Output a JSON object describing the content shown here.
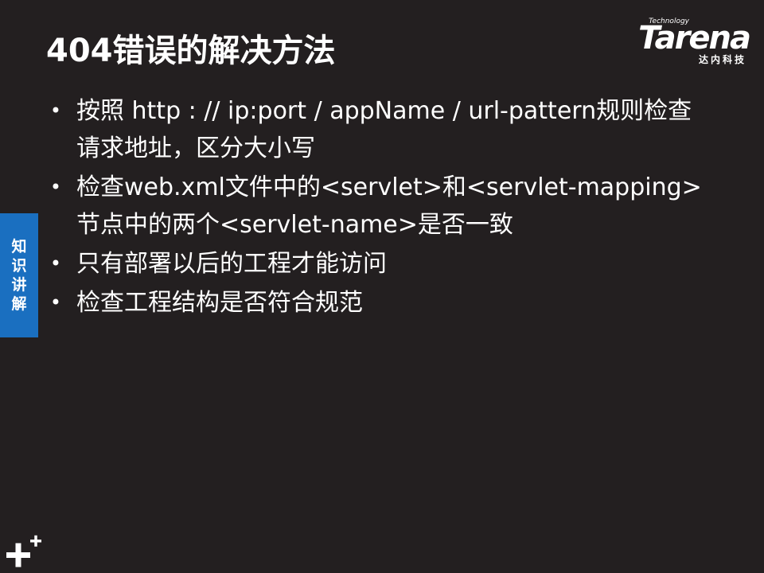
{
  "slide": {
    "title": "404错误的解决方法",
    "brand": {
      "tagline": "Technology",
      "name": "Tarena",
      "subtitle": "达内科技"
    },
    "side_tab": [
      "知",
      "识",
      "讲",
      "解"
    ],
    "bullets": [
      {
        "lines": [
          "按照 http : // ip:port / appName / url-pattern规则检查",
          "请求地址，区分大小写"
        ]
      },
      {
        "lines": [
          "检查web.xml文件中的<servlet>和<servlet-mapping>",
          "节点中的两个<servlet-name>是否一致"
        ]
      },
      {
        "lines": [
          "只有部署以后的工程才能访问"
        ]
      },
      {
        "lines": [
          "检查工程结构是否符合规范"
        ]
      }
    ],
    "colors": {
      "background": "#231f20",
      "accent": "#1a6fc0",
      "text": "#ffffff"
    },
    "icons": {
      "corner": "plus-icon"
    }
  }
}
